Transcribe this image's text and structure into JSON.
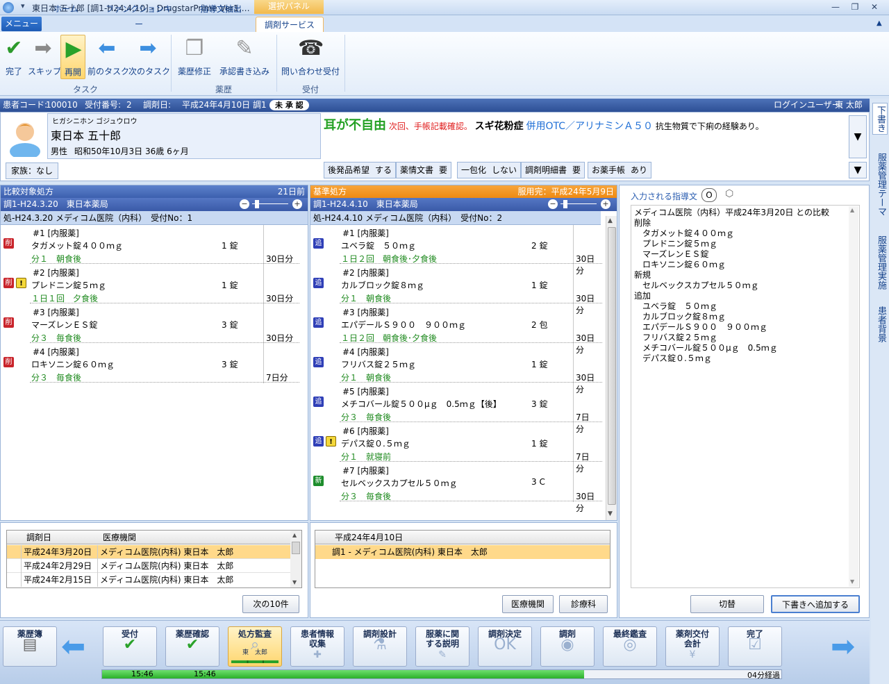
{
  "window": {
    "title": "東日本 五十郎 [調1-H24.4.10] - DrugstarPrime Ver1.…",
    "context_tab": "選択パネル",
    "buttons": [
      "—",
      "❐",
      "✕"
    ]
  },
  "ribbon": {
    "menu": "メニュー",
    "tabs": [
      "ホーム",
      "ファンクションキー",
      "指導文抽出",
      "調剤サービス"
    ],
    "active_tab": "調剤サービス",
    "groups": [
      {
        "label": "タスク",
        "buttons": [
          {
            "label": "完了",
            "icon": "check-icon"
          },
          {
            "label": "スキップ",
            "icon": "skip-arrow-icon"
          },
          {
            "label": "再開",
            "icon": "play-icon"
          },
          {
            "label": "前のタスク",
            "icon": "left-arrow-icon"
          },
          {
            "label": "次のタスク",
            "icon": "right-arrow-icon"
          }
        ]
      },
      {
        "label": "薬歴",
        "buttons": [
          {
            "label": "薬歴修正",
            "icon": "document-stack-icon"
          },
          {
            "label": "承認書き込み",
            "icon": "approve-document-icon"
          }
        ]
      },
      {
        "label": "受付",
        "buttons": [
          {
            "label": "問い合わせ受付",
            "icon": "telephone-icon"
          }
        ]
      }
    ]
  },
  "patient_bar": {
    "code_label": "患者コード:",
    "code": "100010",
    "reception_label": "受付番号:",
    "reception_no": "2",
    "date_label": "調剤日:",
    "date": "平成24年4月10日",
    "dispense": "調1",
    "status": "未 承 認",
    "login_label": "ログインユーザー:",
    "login_user": "東 太郎"
  },
  "patient": {
    "kana": "ヒガシニホン ゴジュウロウ",
    "name": "東日本 五十郎",
    "sex": "男性",
    "birth": "昭和50年10月3日",
    "age": "36歳 6ヶ月",
    "family": "家族：なし",
    "note_main": "耳が不自由",
    "note_red": "次回、手帳記載確認。",
    "note_allergy": "スギ花粉症",
    "note_otc": "併用OTC／アリナミンＡ５０",
    "note_rest": "抗生物質で下痢の経験あり。",
    "flags": [
      {
        "label": "後発品希望",
        "value": "する"
      },
      {
        "label": "薬情文書",
        "value": "要"
      },
      {
        "label": "一包化",
        "value": "しない"
      },
      {
        "label": "調剤明細書",
        "value": "要"
      },
      {
        "label": "お薬手帳",
        "value": "あり"
      }
    ]
  },
  "compare_panel": {
    "header": "比較対象処方",
    "days_ago": "21日前",
    "dispense": "調1-H24.3.20　東日本薬局",
    "rx": "処-H24.3.20 メディコム医院（内科）　受付No：1",
    "drugs": [
      {
        "group": "#1 [内服薬]",
        "name": "タガメット錠４００ｍｇ",
        "qty": "1 錠",
        "usage": "分１　朝食後",
        "days": "30日分",
        "marks": [
          "削"
        ],
        "warn": false
      },
      {
        "group": "#2 [内服薬]",
        "name": "プレドニン錠５ｍｇ",
        "qty": "1 錠",
        "usage": "１日１回　夕食後",
        "days": "30日分",
        "marks": [
          "削"
        ],
        "warn": true
      },
      {
        "group": "#3 [内服薬]",
        "name": "マーズレンＥＳ錠",
        "qty": "3 錠",
        "usage": "分３　毎食後",
        "days": "30日分",
        "marks": [
          "削"
        ],
        "warn": false
      },
      {
        "group": "#4 [内服薬]",
        "name": "ロキソニン錠６０ｍｇ",
        "qty": "3 錠",
        "usage": "分３　毎食後",
        "days": "7日分",
        "marks": [
          "削"
        ],
        "warn": false
      }
    ]
  },
  "base_panel": {
    "header": "基準処方",
    "status": "服用完：平成24年5月9日",
    "dispense": "調1-H24.4.10　東日本薬局",
    "rx": "処-H24.4.10 メディコム医院（内科）　受付No：2",
    "drugs": [
      {
        "group": "#1 [内服薬]",
        "name": "ユベラ錠　５０ｍｇ",
        "qty": "2 錠",
        "usage": "１日２回　朝食後･夕食後",
        "days": "30日分",
        "marks": [
          "追"
        ],
        "warn": false
      },
      {
        "group": "#2 [内服薬]",
        "name": "カルブロック錠８ｍｇ",
        "qty": "1 錠",
        "usage": "分１　朝食後",
        "days": "30日分",
        "marks": [
          "追"
        ],
        "warn": false
      },
      {
        "group": "#3 [内服薬]",
        "name": "エパデールＳ９００　９００ｍｇ",
        "qty": "2 包",
        "usage": "１日２回　朝食後･夕食後",
        "days": "30日分",
        "marks": [
          "追"
        ],
        "warn": false
      },
      {
        "group": "#4 [内服薬]",
        "name": "フリバス錠２５ｍｇ",
        "qty": "1 錠",
        "usage": "分１　朝食後",
        "days": "30日分",
        "marks": [
          "追"
        ],
        "warn": false
      },
      {
        "group": "#5 [内服薬]",
        "name": "メチコバール錠５００μｇ　0.5ｍｇ【後】",
        "qty": "3 錠",
        "usage": "分３　毎食後",
        "days": "7日分",
        "marks": [
          "追"
        ],
        "warn": false
      },
      {
        "group": "#6 [内服薬]",
        "name": "デパス錠０.５ｍｇ",
        "qty": "1 錠",
        "usage": "分１　就寝前",
        "days": "7日分",
        "marks": [
          "追"
        ],
        "warn": true
      },
      {
        "group": "#7 [内服薬]",
        "name": "セルベックスカプセル５０ｍｇ",
        "qty": "3 C",
        "usage": "分３　毎食後",
        "days": "30日分",
        "marks": [
          "新"
        ],
        "warn": false
      }
    ]
  },
  "guidance": {
    "title": "入力される指導文",
    "badge": "O",
    "lines": [
      "メディコム医院（内科）平成24年3月20日 との比較",
      "削除",
      "　タガメット錠４００ｍｇ",
      "　プレドニン錠５ｍｇ",
      "　マーズレンＥＳ錠",
      "　ロキソニン錠６０ｍｇ",
      "新規",
      "　セルベックスカプセル５０ｍｇ",
      "追加",
      "　ユベラ錠　５０ｍｇ",
      "　カルブロック錠８ｍｇ",
      "　エパデールＳ９００　９００ｍｇ",
      "　フリバス錠２５ｍｇ",
      "　メチコバール錠５００μｇ　0.5ｍｇ",
      "　デパス錠０.５ｍｇ"
    ],
    "btn_switch": "切替",
    "btn_add": "下書きへ追加する"
  },
  "history": {
    "col_date": "調剤日",
    "col_inst": "医療機関",
    "rows": [
      {
        "date": "平成24年3月20日",
        "inst": "メディコム医院(内科) 東日本　太郎",
        "selected": true
      },
      {
        "date": "平成24年2月29日",
        "inst": "メディコム医院(内科) 東日本　太郎",
        "selected": false
      },
      {
        "date": "平成24年2月15日",
        "inst": "メディコム医院(内科) 東日本　太郎",
        "selected": false
      }
    ],
    "btn_next": "次の10件"
  },
  "current": {
    "header": "平成24年4月10日",
    "row": "調1 - メディコム医院(内科) 東日本　太郎",
    "btn_inst": "医療機関",
    "btn_dept": "診療科"
  },
  "side_tabs": [
    "下書き",
    "服薬管理テーマ",
    "服薬管理実施",
    "患者背景"
  ],
  "workflow": {
    "left_button": "薬歴簿",
    "steps": [
      {
        "label": "受付",
        "done": true
      },
      {
        "label": "薬歴確認",
        "done": true
      },
      {
        "label": "処方監査",
        "active": true,
        "sub": "東　太郎"
      },
      {
        "label": "患者情報\n収集"
      },
      {
        "label": "調剤設計"
      },
      {
        "label": "服薬に関\nする説明"
      },
      {
        "label": "調剤決定"
      },
      {
        "label": "調剤"
      },
      {
        "label": "最終鑑査"
      },
      {
        "label": "薬剤交付\n会計"
      },
      {
        "label": "完了"
      }
    ],
    "time1": "15:46",
    "time2": "15:46",
    "elapsed": "04分経過",
    "progress_fraction": 0.71
  }
}
